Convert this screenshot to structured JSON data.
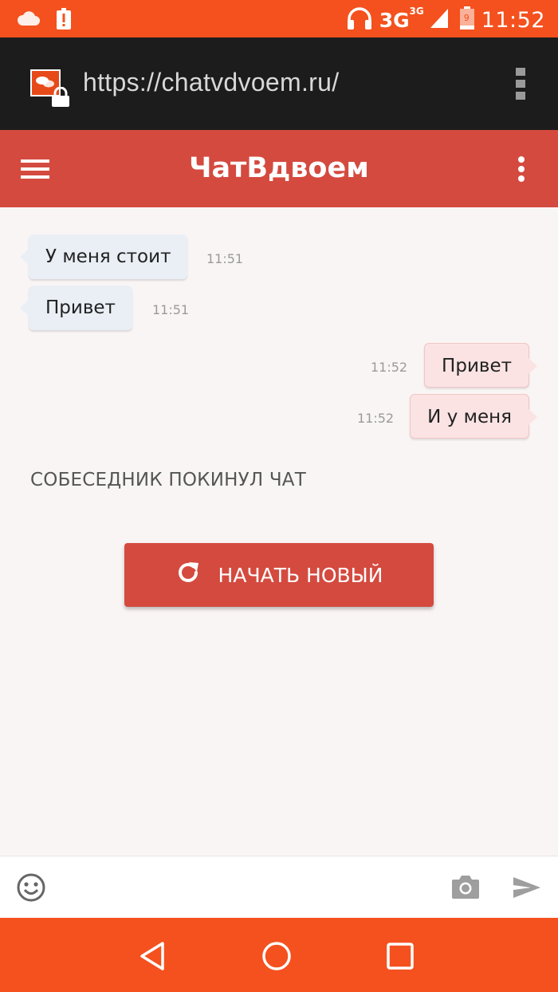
{
  "status_bar": {
    "network": "3G",
    "network_sup": "3G",
    "battery": "9",
    "time": "11:52",
    "icons": [
      "cloud-icon",
      "alert-icon",
      "headphones-icon",
      "signal-icon",
      "battery-icon"
    ]
  },
  "browser": {
    "url": "https://chatvdvoem.ru/"
  },
  "app_bar": {
    "title": "ЧатВдвоем"
  },
  "chat": {
    "messages": [
      {
        "side": "in",
        "text": "У меня стоит",
        "time": "11:51"
      },
      {
        "side": "in",
        "text": "Привет",
        "time": "11:51"
      },
      {
        "side": "out",
        "text": "Привет",
        "time": "11:52"
      },
      {
        "side": "out",
        "text": "И у меня",
        "time": "11:52"
      }
    ],
    "notice": "СОБЕСЕДНИК ПОКИНУЛ ЧАТ",
    "new_chat_label": "НАЧАТЬ НОВЫЙ"
  },
  "input_bar": {
    "placeholder": ""
  },
  "colors": {
    "status_bar": "#f4511e",
    "browser_bar": "#1c1c1c",
    "app_bar": "#d44a3f",
    "incoming_bubble": "#e9eff5",
    "outgoing_bubble": "#fbe3e3",
    "background": "#faf5f5"
  }
}
